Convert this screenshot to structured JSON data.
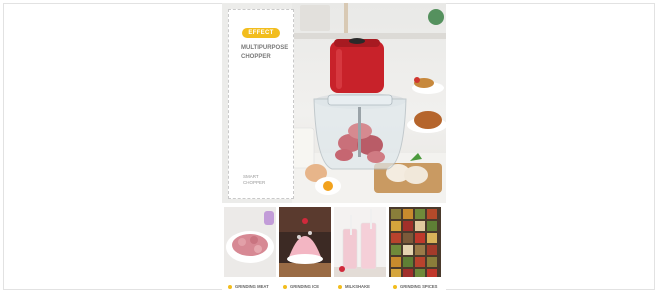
{
  "hero": {
    "badge": "EFFECT",
    "title_line1": "MULTIPURPOSE",
    "title_line2": "CHOPPER",
    "subtitle_line1": "SMART",
    "subtitle_line2": "CHOPPER"
  },
  "thumbnails": [
    {
      "label": "GRINDING MEAT",
      "icon": "minced-meat-image"
    },
    {
      "label": "GRINDING ICE",
      "icon": "shaved-ice-image"
    },
    {
      "label": "MILKSHAKE",
      "icon": "milkshake-image"
    },
    {
      "label": "GRINDING SPICES",
      "icon": "spices-image"
    }
  ],
  "colors": {
    "accent": "#f2bd1d",
    "chopper_red": "#c8222a"
  }
}
